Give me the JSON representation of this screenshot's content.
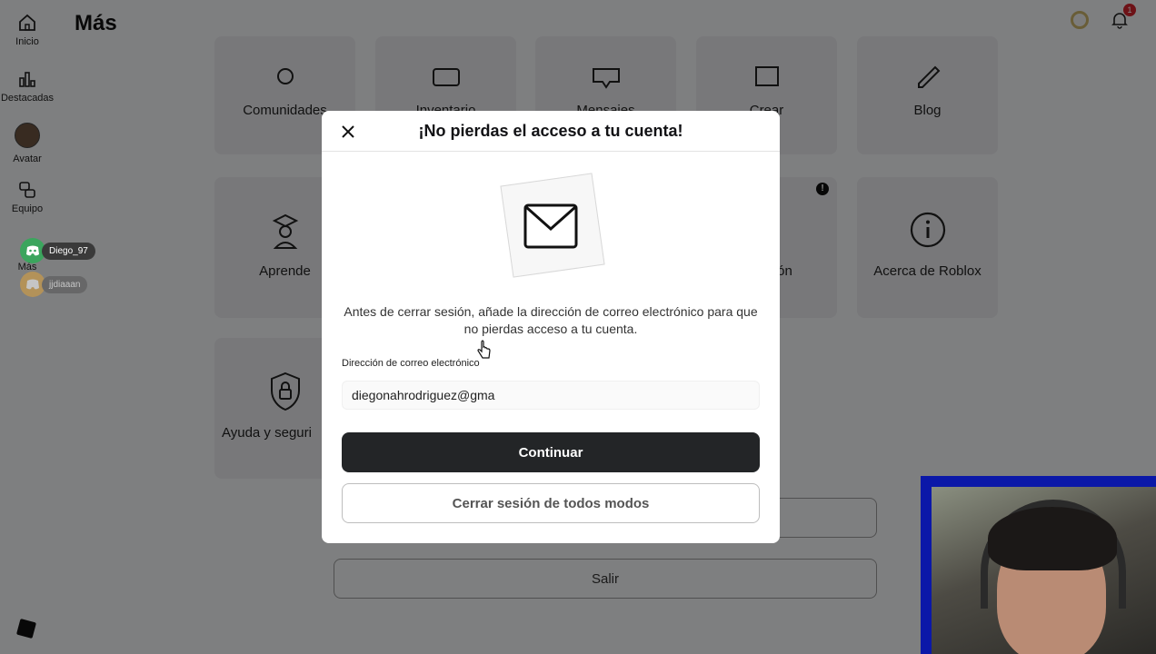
{
  "page": {
    "title": "Más",
    "sidebar": {
      "items": [
        {
          "label": "Inicio",
          "icon": "home-icon"
        },
        {
          "label": "Destacadas",
          "icon": "chart-icon"
        },
        {
          "label": "Avatar",
          "icon": "avatar-icon"
        },
        {
          "label": "Equipo",
          "icon": "team-icon"
        },
        {
          "label": "Más",
          "icon": "more-icon"
        }
      ]
    },
    "notifications": {
      "count": "1"
    },
    "cards": [
      {
        "label": "Comunidades",
        "icon": "communities-icon"
      },
      {
        "label": "Inventario",
        "icon": "inventory-icon"
      },
      {
        "label": "Mensajes",
        "icon": "messages-icon"
      },
      {
        "label": "Crear",
        "icon": "create-icon"
      },
      {
        "label": "Blog",
        "icon": "blog-icon"
      },
      {
        "label": "Aprende",
        "icon": "learn-icon"
      },
      {
        "label": "ación",
        "icon": "settings-icon"
      },
      {
        "label": "Acerca de Roblox",
        "icon": "info-icon"
      },
      {
        "label": "Ayuda y seguri",
        "icon": "shield-lock-icon"
      }
    ],
    "logout_label": "Salir"
  },
  "discord_overlay": {
    "users": [
      {
        "name": "Diego_97",
        "color": "#3ba55d"
      },
      {
        "name": "jjdiaaan",
        "color": "#e0a23a"
      }
    ]
  },
  "modal": {
    "title": "¡No pierdas el acceso a tu cuenta!",
    "body": "Antes de cerrar sesión, añade la dirección de correo electrónico para que no pierdas acceso a tu cuenta.",
    "email_label": "Dirección de correo electrónico",
    "email_value": "diegonahrodriguez@gma",
    "continue_label": "Continuar",
    "logout_anyway_label": "Cerrar sesión de todos modos"
  },
  "colors": {
    "primary_button": "#232527",
    "overlay": "rgba(0,0,0,0.48)",
    "badge": "#d1232c",
    "webcam_border": "#0b18a8"
  }
}
